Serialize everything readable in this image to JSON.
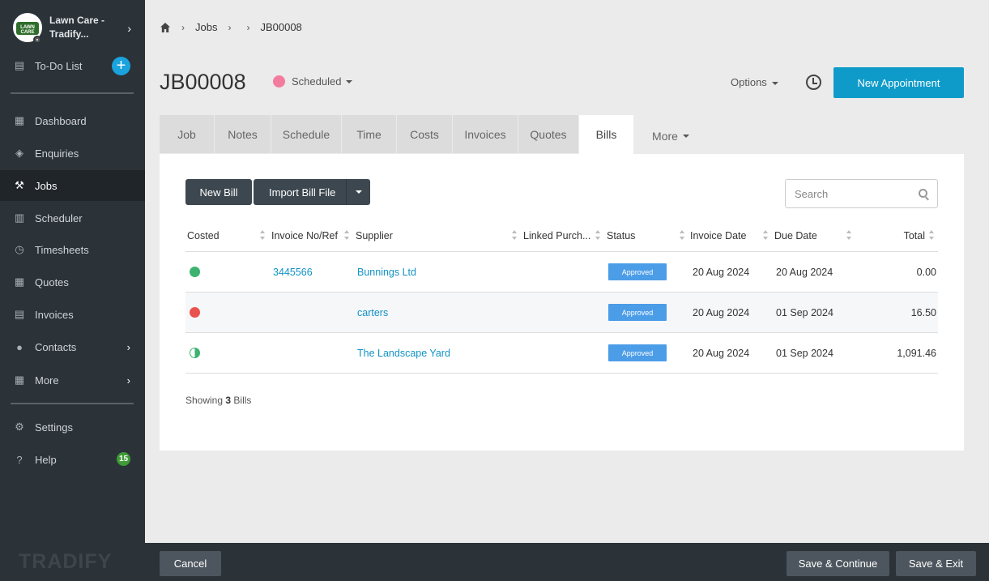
{
  "sidebar": {
    "brand": "Lawn Care - Tradify...",
    "logo_text": "LAWN CARE",
    "todo": "To-Do List",
    "items": [
      {
        "label": "Dashboard",
        "icon": "dashboard-icon"
      },
      {
        "label": "Enquiries",
        "icon": "tags-icon"
      },
      {
        "label": "Jobs",
        "icon": "hammer-icon"
      },
      {
        "label": "Scheduler",
        "icon": "calendar-icon"
      },
      {
        "label": "Timesheets",
        "icon": "clock-icon"
      },
      {
        "label": "Quotes",
        "icon": "calculator-icon"
      },
      {
        "label": "Invoices",
        "icon": "document-icon"
      },
      {
        "label": "Contacts",
        "icon": "users-icon"
      },
      {
        "label": "More",
        "icon": "grid-icon"
      }
    ],
    "settings": "Settings",
    "help": "Help",
    "help_badge": "15",
    "footer_logo": "TRADIFY"
  },
  "breadcrumb": {
    "jobs": "Jobs",
    "current": "JB00008"
  },
  "header": {
    "job_number": "JB00008",
    "status": "Scheduled",
    "status_color": "#f27b9e",
    "options": "Options",
    "new_appointment": "New Appointment"
  },
  "tabs": [
    "Job",
    "Notes",
    "Schedule",
    "Time",
    "Costs",
    "Invoices",
    "Quotes",
    "Bills",
    "More"
  ],
  "bills": {
    "new_bill": "New Bill",
    "import_bill": "Import Bill File",
    "search_placeholder": "Search",
    "columns": [
      "Costed",
      "Invoice No/Ref",
      "Supplier",
      "Linked Purch...",
      "Status",
      "Invoice Date",
      "Due Date",
      "Total"
    ],
    "rows": [
      {
        "costed": "full",
        "invoice_ref": "3445566",
        "supplier": "Bunnings Ltd",
        "linked": "",
        "status": "Approved",
        "invoice_date": "20 Aug 2024",
        "due_date": "20 Aug 2024",
        "total": "0.00"
      },
      {
        "costed": "none",
        "invoice_ref": "",
        "supplier": "carters",
        "linked": "",
        "status": "Approved",
        "invoice_date": "20 Aug 2024",
        "due_date": "01 Sep 2024",
        "total": "16.50"
      },
      {
        "costed": "partial",
        "invoice_ref": "",
        "supplier": "The Landscape Yard",
        "linked": "",
        "status": "Approved",
        "invoice_date": "20 Aug 2024",
        "due_date": "01 Sep 2024",
        "total": "1,091.46"
      }
    ],
    "showing_prefix": "Showing",
    "showing_count": "3",
    "showing_suffix": "Bills"
  },
  "footer": {
    "cancel": "Cancel",
    "save_continue": "Save & Continue",
    "save_exit": "Save & Exit"
  },
  "colors": {
    "accent": "#0f9bc9",
    "costed_full": "#3cb371",
    "costed_none": "#e9534f",
    "approved": "#4b9de8"
  }
}
